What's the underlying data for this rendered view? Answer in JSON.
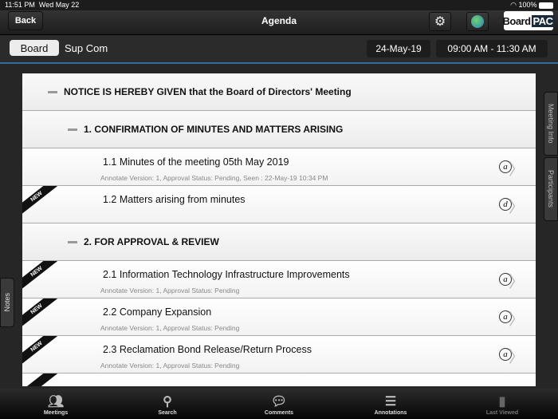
{
  "status": {
    "time": "11:51 PM",
    "date": "Wed May 22",
    "battery": "100%"
  },
  "nav": {
    "back": "Back",
    "title": "Agenda",
    "logo_board": "Board",
    "logo_pac": "PAC"
  },
  "sub": {
    "tabs": [
      "Board",
      "Sup Com"
    ],
    "date": "24-May-19",
    "time": "09:00 AM - 11:30 AM"
  },
  "side": {
    "meeting_info": "Meeting Info",
    "participants": "Participants",
    "notes": "Notes"
  },
  "agenda": {
    "notice": "NOTICE IS HEREBY GIVEN that the Board of Directors' Meeting",
    "sections": [
      {
        "title": "1. CONFIRMATION OF MINUTES AND MATTERS ARISING",
        "items": [
          {
            "title": "1.1 Minutes of the meeting 05th May 2019",
            "meta": "Annotate Version: 1, Approval Status: Pending, Seen : 22-May-19 10:34 PM",
            "icon": "a",
            "new": false
          },
          {
            "title": "1.2 Matters arising from minutes",
            "meta": "",
            "icon": "d",
            "new": true
          }
        ]
      },
      {
        "title": "2. FOR APPROVAL & REVIEW",
        "items": [
          {
            "title": "2.1 Information Technology Infrastructure Improvements",
            "meta": "Annotate Version: 1, Approval Status: Pending",
            "icon": "a",
            "new": true
          },
          {
            "title": "2.2 Company Expansion",
            "meta": "Annotate Version: 1, Approval Status: Pending",
            "icon": "a",
            "new": true
          },
          {
            "title": "2.3 Reclamation Bond Release/Return Process",
            "meta": "Annotate Version: 1, Approval Status: Pending",
            "icon": "a",
            "new": true
          }
        ]
      }
    ],
    "new_label": "NEW"
  },
  "tabbar": [
    {
      "label": "Meetings"
    },
    {
      "label": "Search"
    },
    {
      "label": "Comments"
    },
    {
      "label": "Annotations"
    },
    {
      "label": "Last Viewed"
    }
  ]
}
